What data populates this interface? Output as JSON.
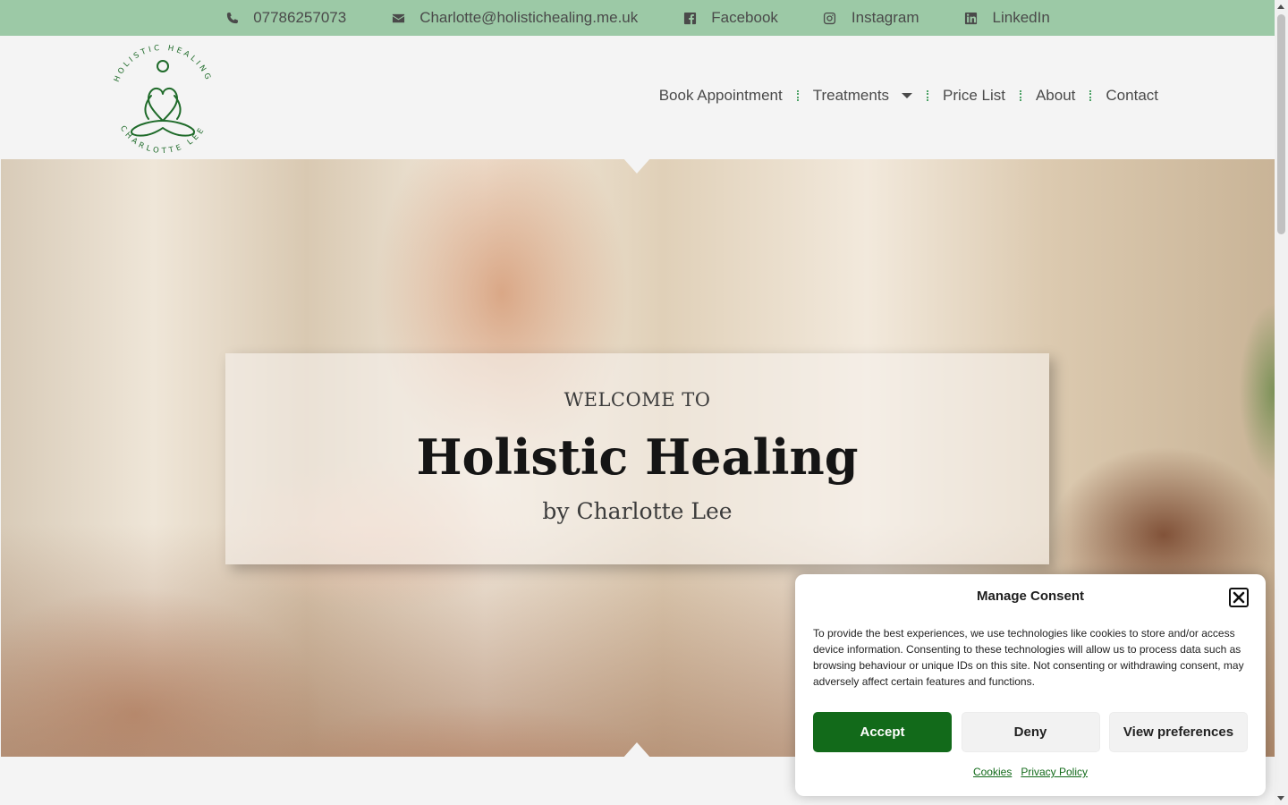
{
  "topbar": {
    "items": [
      {
        "icon": "phone-icon",
        "label": "07786257073"
      },
      {
        "icon": "envelope-icon",
        "label": "Charlotte@holistichealing.me.uk"
      },
      {
        "icon": "facebook-icon",
        "label": "Facebook"
      },
      {
        "icon": "instagram-icon",
        "label": "Instagram"
      },
      {
        "icon": "linkedin-icon",
        "label": "LinkedIn"
      }
    ]
  },
  "logo": {
    "top_text": "HOLISTIC HEALING",
    "bottom_text": "CHARLOTTE LEE"
  },
  "nav": {
    "items": [
      "Book Appointment",
      "Treatments",
      "Price List",
      "About",
      "Contact"
    ]
  },
  "hero": {
    "pre_title": "WELCOME TO",
    "title": "Holistic Healing",
    "subtitle": "by Charlotte Lee"
  },
  "consent": {
    "title": "Manage Consent",
    "body": "To provide the best experiences, we use technologies like cookies to store and/or access device information. Consenting to these technologies will allow us to process data such as browsing behaviour or unique IDs on this site. Not consenting or withdrawing consent, may adversely affect certain features and functions.",
    "accept_label": "Accept",
    "deny_label": "Deny",
    "prefs_label": "View preferences",
    "cookies_link": "Cookies",
    "privacy_link": "Privacy Policy"
  },
  "colors": {
    "topbar_bg": "#9cc9a6",
    "accent_green": "#126a1a",
    "nav_separator": "#4da266",
    "logo_green": "#1f6b2a"
  }
}
